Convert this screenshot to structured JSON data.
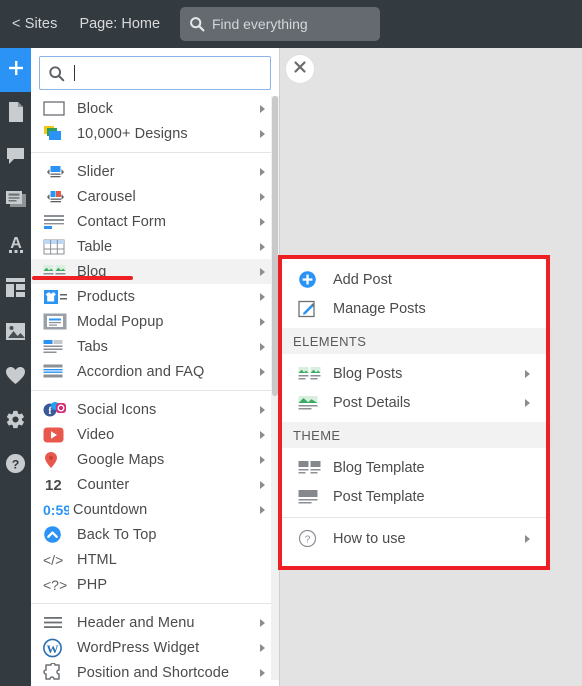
{
  "topbar": {
    "sites_link": "< Sites",
    "page_label": "Page: Home",
    "search_placeholder": "Find everything",
    "search_icon": "search-icon"
  },
  "rail": {
    "items": [
      {
        "name": "add-element",
        "icon": "plus-icon",
        "active": true
      },
      {
        "name": "pages",
        "icon": "page-icon",
        "active": false
      },
      {
        "name": "comments",
        "icon": "comment-icon",
        "active": false
      },
      {
        "name": "blocks",
        "icon": "block-list-icon",
        "active": false
      },
      {
        "name": "typography",
        "icon": "text-a-icon",
        "active": false
      },
      {
        "name": "layout",
        "icon": "layout-icon",
        "active": false
      },
      {
        "name": "images",
        "icon": "image-icon",
        "active": false
      },
      {
        "name": "favorites",
        "icon": "heart-icon",
        "active": false
      },
      {
        "name": "settings",
        "icon": "gear-icon",
        "active": false
      },
      {
        "name": "help",
        "icon": "question-circle-icon",
        "active": false
      }
    ]
  },
  "menu": {
    "search_value": "",
    "search_placeholder": "",
    "search_icon": "search-icon",
    "close_icon": "close-icon",
    "groups": [
      {
        "items": [
          {
            "label": "Block",
            "icon": "rectangle-icon",
            "arrow": true
          },
          {
            "label": "10,000+ Designs",
            "icon": "designs-stack-icon",
            "arrow": true
          }
        ]
      },
      {
        "items": [
          {
            "label": "Slider",
            "icon": "slider-icon",
            "arrow": true
          },
          {
            "label": "Carousel",
            "icon": "carousel-icon",
            "arrow": true
          },
          {
            "label": "Contact Form",
            "icon": "contact-form-icon",
            "arrow": true
          },
          {
            "label": "Table",
            "icon": "table-icon",
            "arrow": true
          },
          {
            "label": "Blog",
            "icon": "blog-icon",
            "arrow": true,
            "selected": true
          },
          {
            "label": "Products",
            "icon": "products-icon",
            "arrow": true
          },
          {
            "label": "Modal Popup",
            "icon": "modal-popup-icon",
            "arrow": true
          },
          {
            "label": "Tabs",
            "icon": "tabs-icon",
            "arrow": true
          },
          {
            "label": "Accordion and FAQ",
            "icon": "accordion-icon",
            "arrow": true
          }
        ]
      },
      {
        "items": [
          {
            "label": "Social Icons",
            "icon": "social-icons-icon",
            "arrow": true
          },
          {
            "label": "Video",
            "icon": "video-icon",
            "arrow": true
          },
          {
            "label": "Google Maps",
            "icon": "map-pin-icon",
            "arrow": true
          },
          {
            "label": "Counter",
            "icon": "counter-12-icon",
            "arrow": true
          },
          {
            "label": "Countdown",
            "icon": "countdown-059-icon",
            "arrow": true
          },
          {
            "label": "Back To Top",
            "icon": "back-to-top-icon",
            "arrow": false
          },
          {
            "label": "HTML",
            "icon": "html-code-icon",
            "arrow": false
          },
          {
            "label": "PHP",
            "icon": "php-code-icon",
            "arrow": false
          }
        ]
      },
      {
        "items": [
          {
            "label": "Header and Menu",
            "icon": "hamburger-icon",
            "arrow": true
          },
          {
            "label": "WordPress Widget",
            "icon": "wordpress-icon",
            "arrow": true
          },
          {
            "label": "Position and Shortcode",
            "icon": "puzzle-icon",
            "arrow": true
          }
        ]
      }
    ]
  },
  "submenu": {
    "highlight_color": "#EE2024",
    "sections": [
      {
        "heading": null,
        "items": [
          {
            "label": "Add Post",
            "icon": "add-circle-icon",
            "arrow": false
          },
          {
            "label": "Manage Posts",
            "icon": "edit-square-icon",
            "arrow": false
          }
        ]
      },
      {
        "heading": "ELEMENTS",
        "items": [
          {
            "label": "Blog Posts",
            "icon": "blog-posts-icon",
            "arrow": true
          },
          {
            "label": "Post Details",
            "icon": "post-details-icon",
            "arrow": true
          }
        ]
      },
      {
        "heading": "THEME",
        "items": [
          {
            "label": "Blog Template",
            "icon": "blog-template-icon",
            "arrow": false
          },
          {
            "label": "Post Template",
            "icon": "post-template-icon",
            "arrow": false
          }
        ]
      },
      {
        "heading": null,
        "items": [
          {
            "label": "How to use",
            "icon": "question-circle-icon",
            "arrow": true
          }
        ]
      }
    ]
  }
}
